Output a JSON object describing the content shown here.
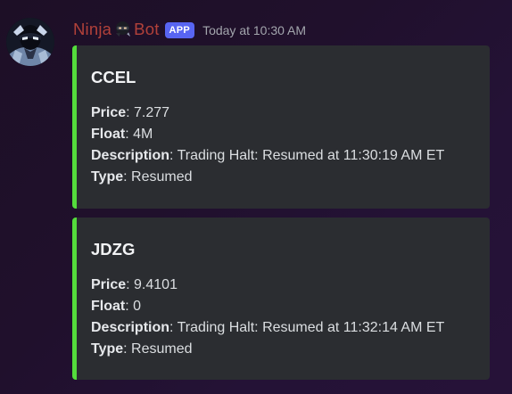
{
  "bot": {
    "name_prefix": "Ninja",
    "name_suffix": "Bot",
    "emoji": "ninja-emoji",
    "badge": "APP",
    "timestamp": "Today at 10:30 AM",
    "name_color": "#b1413a",
    "badge_color": "#5865f2"
  },
  "embeds": [
    {
      "title": "CCEL",
      "accent_color": "#54dc3c",
      "fields": [
        {
          "label": "Price",
          "value": ": 7.277"
        },
        {
          "label": "Float",
          "value": ": 4M"
        },
        {
          "label": "Description",
          "value": ": Trading Halt: Resumed at 11:30:19 AM ET"
        },
        {
          "label": "Type",
          "value": ": Resumed"
        }
      ]
    },
    {
      "title": "JDZG",
      "accent_color": "#54dc3c",
      "fields": [
        {
          "label": "Price",
          "value": ": 9.4101"
        },
        {
          "label": "Float",
          "value": ": 0"
        },
        {
          "label": "Description",
          "value": ": Trading Halt: Resumed at 11:32:14 AM ET"
        },
        {
          "label": "Type",
          "value": ": Resumed"
        }
      ]
    }
  ]
}
